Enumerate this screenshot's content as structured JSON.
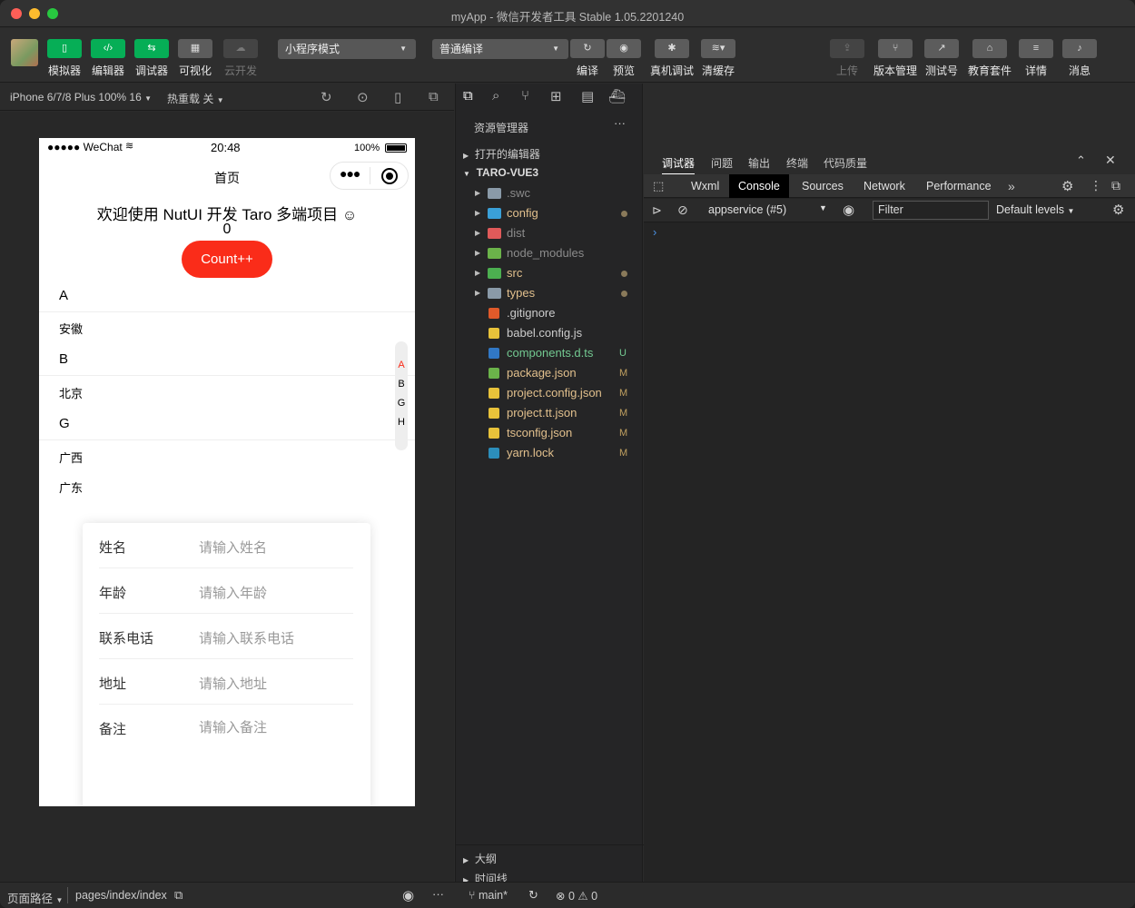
{
  "window": {
    "title": "myApp - 微信开发者工具 Stable 1.05.2201240"
  },
  "toolbar": {
    "simulator": "模拟器",
    "editor": "编辑器",
    "debugger": "调试器",
    "visual": "可视化",
    "cloud": "云开发",
    "mode_select": "小程序模式",
    "compile_select": "普通编译",
    "compile": "编译",
    "preview": "预览",
    "remote_debug": "真机调试",
    "clear_cache": "清缓存",
    "upload": "上传",
    "version": "版本管理",
    "test_account": "测试号",
    "edu": "教育套件",
    "details": "详情",
    "messages": "消息"
  },
  "simbar": {
    "device": "iPhone 6/7/8 Plus 100% 16",
    "hot_reload": "热重载 关"
  },
  "phone": {
    "status_left": "●●●●● WeChat",
    "time": "20:48",
    "battery": "100%",
    "nav_title": "首页",
    "welcome": "欢迎使用 NutUI 开发 Taro 多端项目",
    "count": "0",
    "count_button": "Count++",
    "groups": [
      {
        "letter": "A",
        "items": [
          "安徽"
        ]
      },
      {
        "letter": "B",
        "items": [
          "北京"
        ]
      },
      {
        "letter": "G",
        "items": [
          "广西",
          "广东"
        ]
      }
    ],
    "index_letters": [
      "A",
      "B",
      "G",
      "H"
    ],
    "form": [
      {
        "label": "姓名",
        "placeholder": "请输入姓名"
      },
      {
        "label": "年龄",
        "placeholder": "请输入年龄"
      },
      {
        "label": "联系电话",
        "placeholder": "请输入联系电话"
      },
      {
        "label": "地址",
        "placeholder": "请输入地址"
      },
      {
        "label": "备注",
        "placeholder": "请输入备注"
      }
    ]
  },
  "explorer": {
    "header": "资源管理器",
    "open_editors": "打开的编辑器",
    "project": "TARO-VUE3",
    "files": [
      {
        "name": ".swc",
        "folder": true,
        "color": "#8a9aa8",
        "text": "#8b8b8b",
        "status": ""
      },
      {
        "name": "config",
        "folder": true,
        "color": "#3aa0d8",
        "text": "#e2c08d",
        "status": "dot"
      },
      {
        "name": "dist",
        "folder": true,
        "color": "#e05a5a",
        "text": "#8b8b8b",
        "status": ""
      },
      {
        "name": "node_modules",
        "folder": true,
        "color": "#6bb34a",
        "text": "#8b8b8b",
        "status": ""
      },
      {
        "name": "src",
        "folder": true,
        "color": "#4caf50",
        "text": "#e2c08d",
        "status": "dot"
      },
      {
        "name": "types",
        "folder": true,
        "color": "#8a9aa8",
        "text": "#e2c08d",
        "status": "dot"
      },
      {
        "name": ".gitignore",
        "folder": false,
        "color": "#e05a2a",
        "text": "#cccccc",
        "status": ""
      },
      {
        "name": "babel.config.js",
        "folder": false,
        "color": "#e8c23a",
        "text": "#cccccc",
        "status": ""
      },
      {
        "name": "components.d.ts",
        "folder": false,
        "color": "#3178c6",
        "text": "#73c991",
        "status": "U"
      },
      {
        "name": "package.json",
        "folder": false,
        "color": "#6bb34a",
        "text": "#e2c08d",
        "status": "M"
      },
      {
        "name": "project.config.json",
        "folder": false,
        "color": "#e8c23a",
        "text": "#e2c08d",
        "status": "M"
      },
      {
        "name": "project.tt.json",
        "folder": false,
        "color": "#e8c23a",
        "text": "#e2c08d",
        "status": "M"
      },
      {
        "name": "tsconfig.json",
        "folder": false,
        "color": "#e8c23a",
        "text": "#e2c08d",
        "status": "M"
      },
      {
        "name": "yarn.lock",
        "folder": false,
        "color": "#2c8ebb",
        "text": "#e2c08d",
        "status": "M"
      }
    ],
    "outline": "大纲",
    "timeline": "时间线"
  },
  "devtools": {
    "panel_tabs": [
      "调试器",
      "问题",
      "输出",
      "终端",
      "代码质量"
    ],
    "tabs": [
      "Wxml",
      "Console",
      "Sources",
      "Network",
      "Performance"
    ],
    "active_tab": "Console",
    "context": "appservice (#5)",
    "filter_placeholder": "Filter",
    "levels": "Default levels"
  },
  "status": {
    "page_path_label": "页面路径",
    "page_path": "pages/index/index",
    "branch": "main*",
    "errors": "0",
    "warnings": "0"
  }
}
